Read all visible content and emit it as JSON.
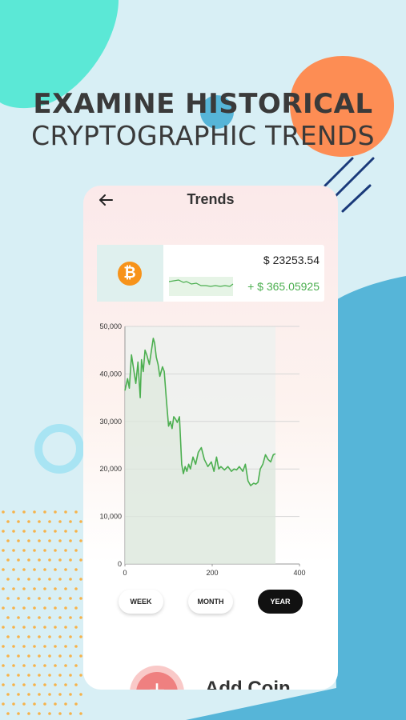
{
  "headline": {
    "line1": "EXAMINE HISTORICAL",
    "line2": "CRYPTOGRAPHIC TRENDS"
  },
  "colors": {
    "background": "#d8eff5",
    "teal_blob": "#5be8d6",
    "orange_blob": "#fd8d54",
    "blue_blob": "#56b5d8",
    "accent_green": "#4caf50",
    "btc_orange": "#f7931a"
  },
  "app": {
    "header": {
      "title": "Trends",
      "back_icon": "arrow-left-icon"
    },
    "coin_card": {
      "icon": "bitcoin-icon",
      "price": "$ 23253.54",
      "change": "+ $ 365.05925"
    },
    "timeframes": [
      {
        "label": "WEEK",
        "selected": false
      },
      {
        "label": "MONTH",
        "selected": false
      },
      {
        "label": "YEAR",
        "selected": true
      }
    ],
    "add_coin": {
      "label": "Add Coin",
      "icon": "plus-icon"
    }
  },
  "chart_data": {
    "type": "line",
    "xlim": [
      0,
      400
    ],
    "ylim": [
      0,
      50000
    ],
    "xticks": [
      "0",
      "200",
      "400"
    ],
    "yticks": [
      "0",
      "10,000",
      "20,000",
      "30,000",
      "40,000",
      "50,000"
    ],
    "grid": true,
    "series": [
      {
        "color": "#4caf50",
        "x": [
          0,
          6,
          10,
          15,
          20,
          25,
          30,
          35,
          38,
          42,
          46,
          50,
          56,
          60,
          65,
          68,
          72,
          76,
          80,
          86,
          90,
          95,
          100,
          104,
          108,
          112,
          116,
          120,
          125,
          130,
          134,
          138,
          142,
          146,
          150,
          156,
          162,
          168,
          175,
          182,
          190,
          198,
          204,
          210,
          215,
          220,
          228,
          236,
          244,
          250,
          256,
          262,
          270,
          276,
          282,
          288,
          295,
          300,
          305,
          310,
          316,
          322,
          328,
          334,
          340,
          345
        ],
        "values": [
          36500,
          39000,
          37000,
          44000,
          41000,
          38000,
          42500,
          35000,
          43000,
          40500,
          45000,
          44000,
          42000,
          44500,
          47500,
          46500,
          43500,
          42000,
          39500,
          41500,
          40500,
          34500,
          29000,
          30000,
          28500,
          31000,
          30500,
          29800,
          31000,
          21000,
          19000,
          20500,
          19500,
          21000,
          20000,
          22500,
          21000,
          23500,
          24500,
          22000,
          20500,
          21500,
          19500,
          22500,
          20000,
          20500,
          19800,
          20500,
          19500,
          20000,
          19800,
          20500,
          19500,
          21000,
          17500,
          16500,
          17000,
          16800,
          17200,
          20000,
          21000,
          23000,
          22000,
          21500,
          23000,
          23200
        ]
      }
    ]
  }
}
